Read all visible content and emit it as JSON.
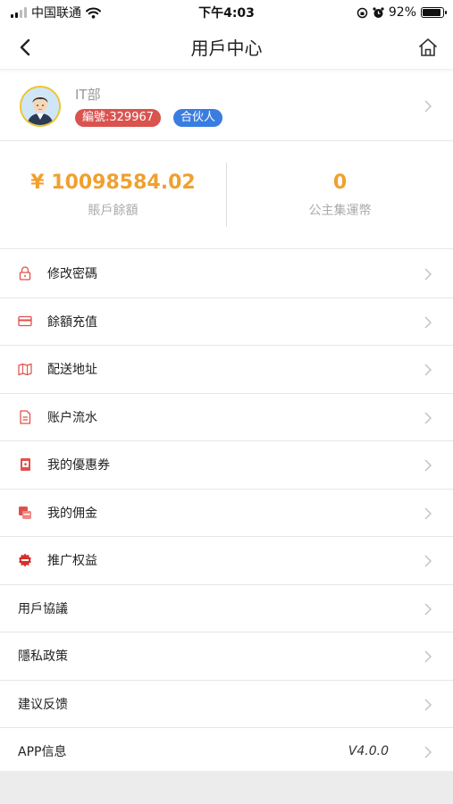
{
  "status_bar": {
    "carrier": "中国联通",
    "time": "下午4:03",
    "battery": "92%",
    "battery_level": 0.92
  },
  "nav": {
    "title": "用戶中心"
  },
  "profile": {
    "name": "IT部",
    "member_id_badge": "編號:329967",
    "role_badge": "合伙人"
  },
  "stats": [
    {
      "value": "¥ 10098584.02",
      "label": "賬戶餘額"
    },
    {
      "value": "0",
      "label": "公主集運幣"
    }
  ],
  "menu": [
    {
      "label": "修改密碼",
      "icon": "lock-icon"
    },
    {
      "label": "餘額充值",
      "icon": "card-icon"
    },
    {
      "label": "配送地址",
      "icon": "map-icon"
    },
    {
      "label": "账户流水",
      "icon": "document-icon"
    },
    {
      "label": "我的優惠券",
      "icon": "coupon-icon"
    },
    {
      "label": "我的佣金",
      "icon": "coins-icon"
    },
    {
      "label": "推广权益",
      "icon": "promo-badge-icon"
    },
    {
      "label": "用戶協議"
    },
    {
      "label": "隱私政策"
    },
    {
      "label": "建议反馈"
    },
    {
      "label": "APP信息",
      "value": "V4.0.0"
    }
  ],
  "colors": {
    "accent_orange": "#f0a030",
    "badge_red": "#d9534f",
    "badge_blue": "#3a7de0",
    "icon_red": "#e0504b"
  }
}
